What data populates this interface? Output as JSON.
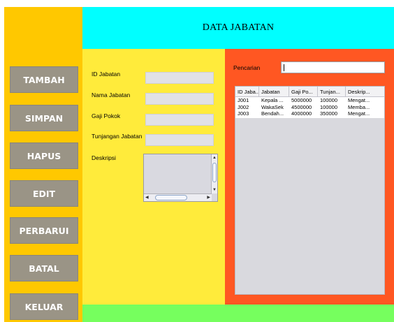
{
  "header": {
    "title": "DATA JABATAN"
  },
  "sidebar": {
    "items": [
      {
        "label": "TAMBAH"
      },
      {
        "label": "SIMPAN"
      },
      {
        "label": "HAPUS"
      },
      {
        "label": "EDIT"
      },
      {
        "label": "PERBARUI"
      },
      {
        "label": "BATAL"
      },
      {
        "label": "KELUAR"
      }
    ]
  },
  "form": {
    "id_label": "ID Jabatan",
    "nama_label": "Nama Jabatan",
    "gaji_label": "Gaji Pokok",
    "tunjangan_label": "Tunjangan Jabatan",
    "deskripsi_label": "Deskripsi",
    "id_value": "",
    "nama_value": "",
    "gaji_value": "",
    "tunjangan_value": "",
    "deskripsi_value": ""
  },
  "search": {
    "label": "Pencarian",
    "value": ""
  },
  "table": {
    "columns": [
      "ID Jaba...",
      "Jabatan",
      "Gaji Po...",
      "Tunjan...",
      "Deskrip..."
    ],
    "rows": [
      [
        "J001",
        "Kepala ...",
        "5000000",
        "100000",
        "Mengat..."
      ],
      [
        "J002",
        "WakaSek",
        "4500000",
        "100000",
        "Memba..."
      ],
      [
        "J003",
        "Bendah...",
        "4000000",
        "350000",
        "Mengat..."
      ]
    ]
  },
  "colors": {
    "sidebar": "#FFC800",
    "header": "#00FFFF",
    "form": "#FFEB3B",
    "panel": "#FF5722",
    "footer": "#76FF5E",
    "button": "#9A9486"
  }
}
